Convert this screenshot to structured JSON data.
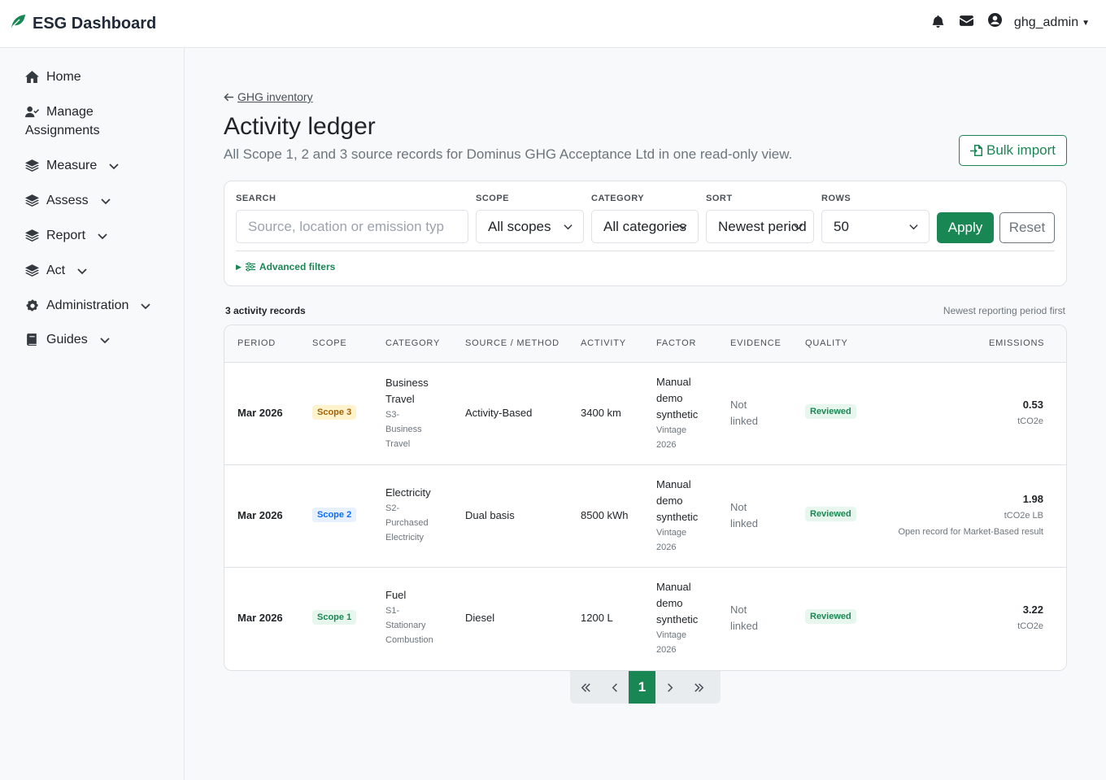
{
  "brand": {
    "title": "ESG Dashboard"
  },
  "topbar": {
    "username": "ghg_admin"
  },
  "sidebar": {
    "items": [
      {
        "label": "Home",
        "icon": "home-icon"
      },
      {
        "label": "Manage",
        "label2": "Assignments",
        "icon": "user-check-icon"
      },
      {
        "label": "Measure",
        "icon": "layers-icon"
      },
      {
        "label": "Assess",
        "icon": "layers-icon"
      },
      {
        "label": "Report",
        "icon": "layers-icon"
      },
      {
        "label": "Act",
        "icon": "layers-icon"
      },
      {
        "label": "Administration",
        "icon": "gear-icon"
      },
      {
        "label": "Guides",
        "icon": "book-icon"
      }
    ]
  },
  "header": {
    "back_label": "GHG inventory",
    "title": "Activity ledger",
    "subtitle": "All Scope 1, 2 and 3 source records for Dominus GHG Acceptance Ltd in one read-only view.",
    "bulk_import_label": "Bulk import"
  },
  "filters": {
    "search_label": "SEARCH",
    "search_placeholder": "Source, location or emission typ",
    "scope_label": "SCOPE",
    "scope_value": "All scopes",
    "category_label": "CATEGORY",
    "category_value": "All categories",
    "sort_label": "SORT",
    "sort_value": "Newest period",
    "rows_label": "ROWS",
    "rows_value": "50",
    "apply_label": "Apply",
    "reset_label": "Reset",
    "advanced_label": "Advanced filters"
  },
  "summary": {
    "count": "3 activity records",
    "sort_note": "Newest reporting period first"
  },
  "table": {
    "headers": [
      "PERIOD",
      "SCOPE",
      "CATEGORY",
      "SOURCE / METHOD",
      "ACTIVITY",
      "FACTOR",
      "EVIDENCE",
      "QUALITY",
      "EMISSIONS"
    ],
    "rows": [
      {
        "period": "Mar 2026",
        "scope": "Scope 3",
        "category_l1": "Business",
        "category_l2": "Travel",
        "cat_sub_1": "S3-",
        "cat_sub_2": "Business",
        "cat_sub_3": "Travel",
        "source": "Activity-Based",
        "activity": "3400 km",
        "factor_1": "Manual",
        "factor_2": "demo",
        "factor_3": "synthetic",
        "vintage_1": "Vintage",
        "vintage_2": "2026",
        "evidence_1": "Not",
        "evidence_2": "linked",
        "quality": "Reviewed",
        "emissions": "0.53",
        "unit": "tCO2e",
        "note": ""
      },
      {
        "period": "Mar 2026",
        "scope": "Scope 2",
        "category_l1": "Electricity",
        "category_l2": "",
        "cat_sub_1": "S2-",
        "cat_sub_2": "Purchased",
        "cat_sub_3": "Electricity",
        "source": "Dual basis",
        "activity": "8500 kWh",
        "factor_1": "Manual",
        "factor_2": "demo",
        "factor_3": "synthetic",
        "vintage_1": "Vintage",
        "vintage_2": "2026",
        "evidence_1": "Not",
        "evidence_2": "linked",
        "quality": "Reviewed",
        "emissions": "1.98",
        "unit": "tCO2e LB",
        "note": "Open record for Market-Based result"
      },
      {
        "period": "Mar 2026",
        "scope": "Scope 1",
        "category_l1": "Fuel",
        "category_l2": "",
        "cat_sub_1": "S1-",
        "cat_sub_2": "Stationary",
        "cat_sub_3": "Combustion",
        "source": "Diesel",
        "activity": "1200 L",
        "factor_1": "Manual",
        "factor_2": "demo",
        "factor_3": "synthetic",
        "vintage_1": "Vintage",
        "vintage_2": "2026",
        "evidence_1": "Not",
        "evidence_2": "linked",
        "quality": "Reviewed",
        "emissions": "3.22",
        "unit": "tCO2e",
        "note": ""
      }
    ]
  },
  "pagination": {
    "current": "1"
  },
  "colors": {
    "accent": "#198754",
    "scope3": "#a16207",
    "scope2": "#0d6efd",
    "scope1": "#198754"
  }
}
